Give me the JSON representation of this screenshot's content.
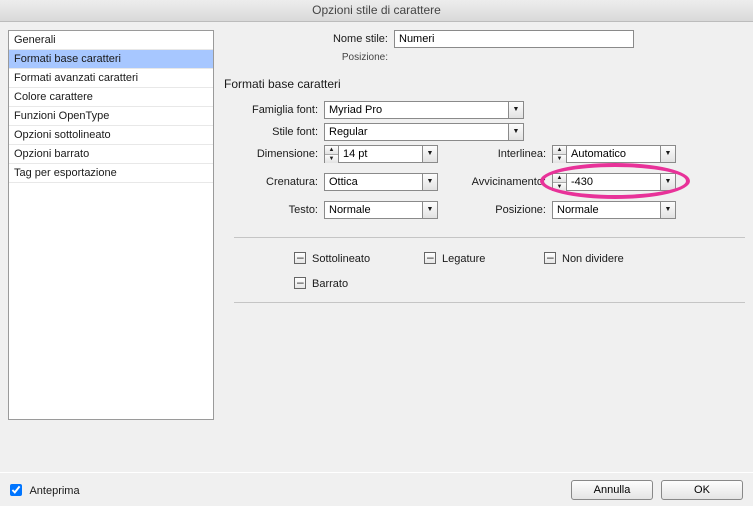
{
  "title": "Opzioni stile di carattere",
  "sidebar": {
    "items": [
      {
        "label": "Generali",
        "selected": false
      },
      {
        "label": "Formati base caratteri",
        "selected": true
      },
      {
        "label": "Formati avanzati caratteri",
        "selected": false
      },
      {
        "label": "Colore carattere",
        "selected": false
      },
      {
        "label": "Funzioni OpenType",
        "selected": false
      },
      {
        "label": "Opzioni sottolineato",
        "selected": false
      },
      {
        "label": "Opzioni barrato",
        "selected": false
      },
      {
        "label": "Tag per esportazione",
        "selected": false
      }
    ]
  },
  "header": {
    "style_name_label": "Nome stile:",
    "style_name": "Numeri",
    "position_label": "Posizione:"
  },
  "section_title": "Formati base caratteri",
  "fields": {
    "family_label": "Famiglia font:",
    "family_value": "Myriad Pro",
    "style_label": "Stile font:",
    "style_value": "Regular",
    "size_label": "Dimensione:",
    "size_value": "14 pt",
    "leading_label": "Interlinea:",
    "leading_value": "Automatico",
    "kerning_label": "Crenatura:",
    "kerning_value": "Ottica",
    "tracking_label": "Avvicinamento:",
    "tracking_value": "-430",
    "case_label": "Testo:",
    "case_value": "Normale",
    "position_label": "Posizione:",
    "position_value": "Normale"
  },
  "checks": {
    "underline": "Sottolineato",
    "ligatures": "Legature",
    "nobreak": "Non dividere",
    "strike": "Barrato"
  },
  "footer": {
    "preview": "Anteprima",
    "cancel": "Annulla",
    "ok": "OK"
  }
}
